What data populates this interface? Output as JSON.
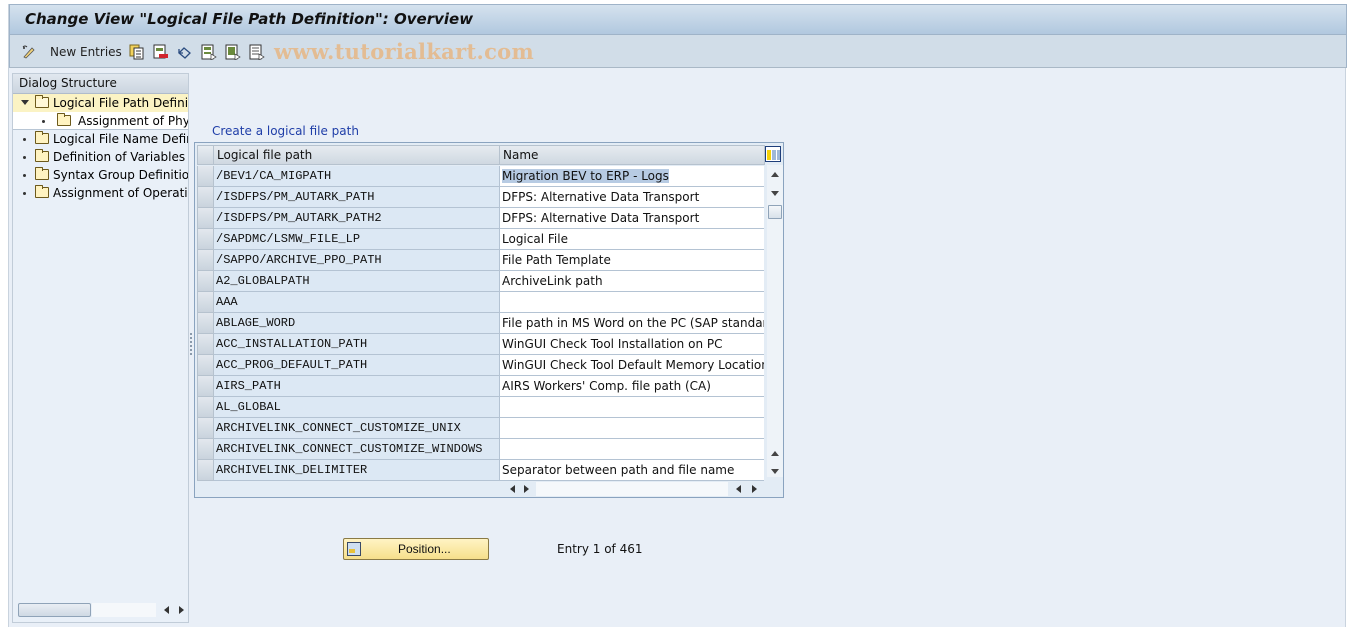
{
  "window": {
    "title": "Change View \"Logical File Path Definition\": Overview"
  },
  "toolbar": {
    "items": [
      {
        "icon": "display-change-icon",
        "label": ""
      },
      {
        "icon": "new-entries-icon",
        "label": "New Entries"
      },
      {
        "icon": "copy-as-icon",
        "label": ""
      },
      {
        "icon": "delete-icon",
        "label": ""
      },
      {
        "icon": "undo-change-icon",
        "label": ""
      },
      {
        "icon": "select-all-icon",
        "label": ""
      },
      {
        "icon": "select-block-icon",
        "label": ""
      },
      {
        "icon": "deselect-all-icon",
        "label": ""
      }
    ],
    "watermark": "www.tutorialkart.com"
  },
  "dialog_structure": {
    "header": "Dialog Structure",
    "items": [
      {
        "label": "Logical File Path Definition",
        "level": 0,
        "expanded": true,
        "selected": true
      },
      {
        "label": "Assignment of Physical Paths to Logical Path",
        "level": 1,
        "selected": false
      },
      {
        "label": "Logical File Name Definition, Cross-Client",
        "level": 0,
        "selected": false
      },
      {
        "label": "Definition of Variables",
        "level": 0,
        "selected": false
      },
      {
        "label": "Syntax Group Definition",
        "level": 0,
        "selected": false
      },
      {
        "label": "Assignment of Operating System to Syntax Group",
        "level": 0,
        "selected": false
      }
    ]
  },
  "main": {
    "table_title": "Create a logical file path",
    "columns": [
      "Logical file path",
      "Name"
    ],
    "rows": [
      {
        "path": "/BEV1/CA_MIGPATH",
        "name": "Migration BEV to ERP - Logs",
        "highlighted": true
      },
      {
        "path": "/ISDFPS/PM_AUTARK_PATH",
        "name": "DFPS: Alternative Data Transport"
      },
      {
        "path": "/ISDFPS/PM_AUTARK_PATH2",
        "name": "DFPS: Alternative Data Transport"
      },
      {
        "path": "/SAPDMC/LSMW_FILE_LP",
        "name": "Logical File"
      },
      {
        "path": "/SAPPO/ARCHIVE_PPO_PATH",
        "name": "File Path Template"
      },
      {
        "path": "A2_GLOBALPATH",
        "name": "ArchiveLink path"
      },
      {
        "path": "AAA",
        "name": ""
      },
      {
        "path": "ABLAGE_WORD",
        "name": "File path in MS Word on the PC (SAP standard in"
      },
      {
        "path": "ACC_INSTALLATION_PATH",
        "name": "WinGUI Check Tool Installation on PC"
      },
      {
        "path": "ACC_PROG_DEFAULT_PATH",
        "name": "WinGUI Check Tool Default Memory Location"
      },
      {
        "path": "AIRS_PATH",
        "name": "AIRS Workers' Comp. file path (CA)"
      },
      {
        "path": "AL_GLOBAL",
        "name": ""
      },
      {
        "path": "ARCHIVELINK_CONNECT_CUSTOMIZE_UNIX",
        "name": ""
      },
      {
        "path": "ARCHIVELINK_CONNECT_CUSTOMIZE_WINDOWS",
        "name": ""
      },
      {
        "path": "ARCHIVELINK_DELIMITER",
        "name": "Separator between path and file name"
      }
    ],
    "position_button": "Position...",
    "entry_info": "Entry 1 of 461"
  },
  "colors": {
    "background": "#e9eff7",
    "title_bar": "#b1c8df",
    "selected_tree_item": "#fbf3c4",
    "link": "#1f3ea8",
    "position_button": "#f6df8b",
    "cell_highlight": "#b7cbe3"
  }
}
